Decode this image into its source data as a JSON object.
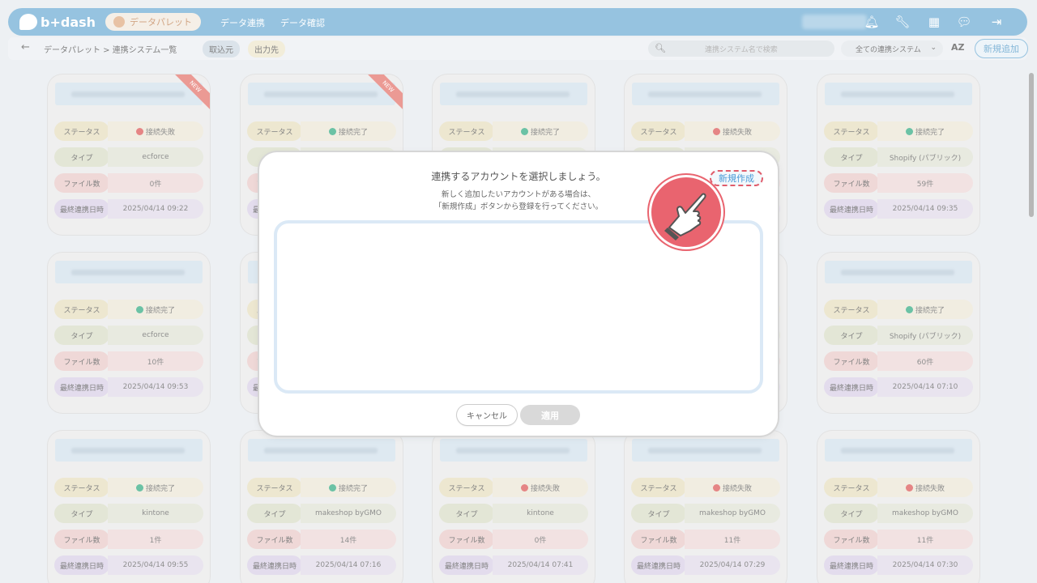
{
  "header": {
    "logo_text": "b+dash",
    "palette_label": "データパレット",
    "nav": [
      "データ連携",
      "データ確認"
    ]
  },
  "subbar": {
    "breadcrumb": "データパレット > 連携システム一覧",
    "tab_source": "取込元",
    "tab_dest": "出力先",
    "search_placeholder": "連携システム名で検索",
    "filter_value": "全ての連携システム",
    "sort_label": "AZ",
    "add_label": "新規追加"
  },
  "card_labels": {
    "status": "ステータス",
    "type": "タイプ",
    "files": "ファイル数",
    "last_sync": "最終連携日時"
  },
  "cards": [
    {
      "status": "接続失敗",
      "type": "ecforce",
      "files": "0件",
      "date": "2025/04/14 09:22",
      "ok": false,
      "is_new": true
    },
    {
      "status": "接続完了",
      "type": "",
      "files": "",
      "date": "",
      "ok": true,
      "is_new": true
    },
    {
      "status": "接続完了",
      "type": "",
      "files": "",
      "date": "",
      "ok": true,
      "is_new": false
    },
    {
      "status": "接続失敗",
      "type": "",
      "files": "",
      "date": "",
      "ok": false,
      "is_new": false
    },
    {
      "status": "接続完了",
      "type": "Shopify (パブリック)",
      "files": "59件",
      "date": "2025/04/14 09:35",
      "ok": true,
      "is_new": false
    },
    {
      "status": "接続完了",
      "type": "ecforce",
      "files": "10件",
      "date": "2025/04/14 09:53",
      "ok": true,
      "is_new": false
    },
    {
      "status": "",
      "type": "",
      "files": "",
      "date": "",
      "ok": true,
      "is_new": false
    },
    {
      "status": "",
      "type": "",
      "files": "",
      "date": "",
      "ok": true,
      "is_new": false
    },
    {
      "status": "",
      "type": "",
      "files": "",
      "date": "",
      "ok": true,
      "is_new": false
    },
    {
      "status": "接続完了",
      "type": "Shopify (パブリック)",
      "files": "60件",
      "date": "2025/04/14 07:10",
      "ok": true,
      "is_new": false
    },
    {
      "status": "接続完了",
      "type": "kintone",
      "files": "1件",
      "date": "2025/04/14 09:55",
      "ok": true,
      "is_new": false
    },
    {
      "status": "接続完了",
      "type": "makeshop byGMO",
      "files": "14件",
      "date": "2025/04/14 07:16",
      "ok": true,
      "is_new": false
    },
    {
      "status": "接続失敗",
      "type": "kintone",
      "files": "0件",
      "date": "2025/04/14 07:41",
      "ok": false,
      "is_new": false
    },
    {
      "status": "接続失敗",
      "type": "makeshop byGMO",
      "files": "11件",
      "date": "2025/04/14 07:29",
      "ok": false,
      "is_new": false
    },
    {
      "status": "接続失敗",
      "type": "makeshop byGMO",
      "files": "11件",
      "date": "2025/04/14 07:30",
      "ok": false,
      "is_new": false
    }
  ],
  "new_badge": "NEW",
  "modal": {
    "title": "連携するアカウントを選択しましょう。",
    "sub1": "新しく追加したいアカウントがある場合は、",
    "sub2": "「新規作成」ボタンから登録を行ってください。",
    "new_label": "新規作成",
    "cancel_label": "キャンセル",
    "apply_label": "適用"
  }
}
